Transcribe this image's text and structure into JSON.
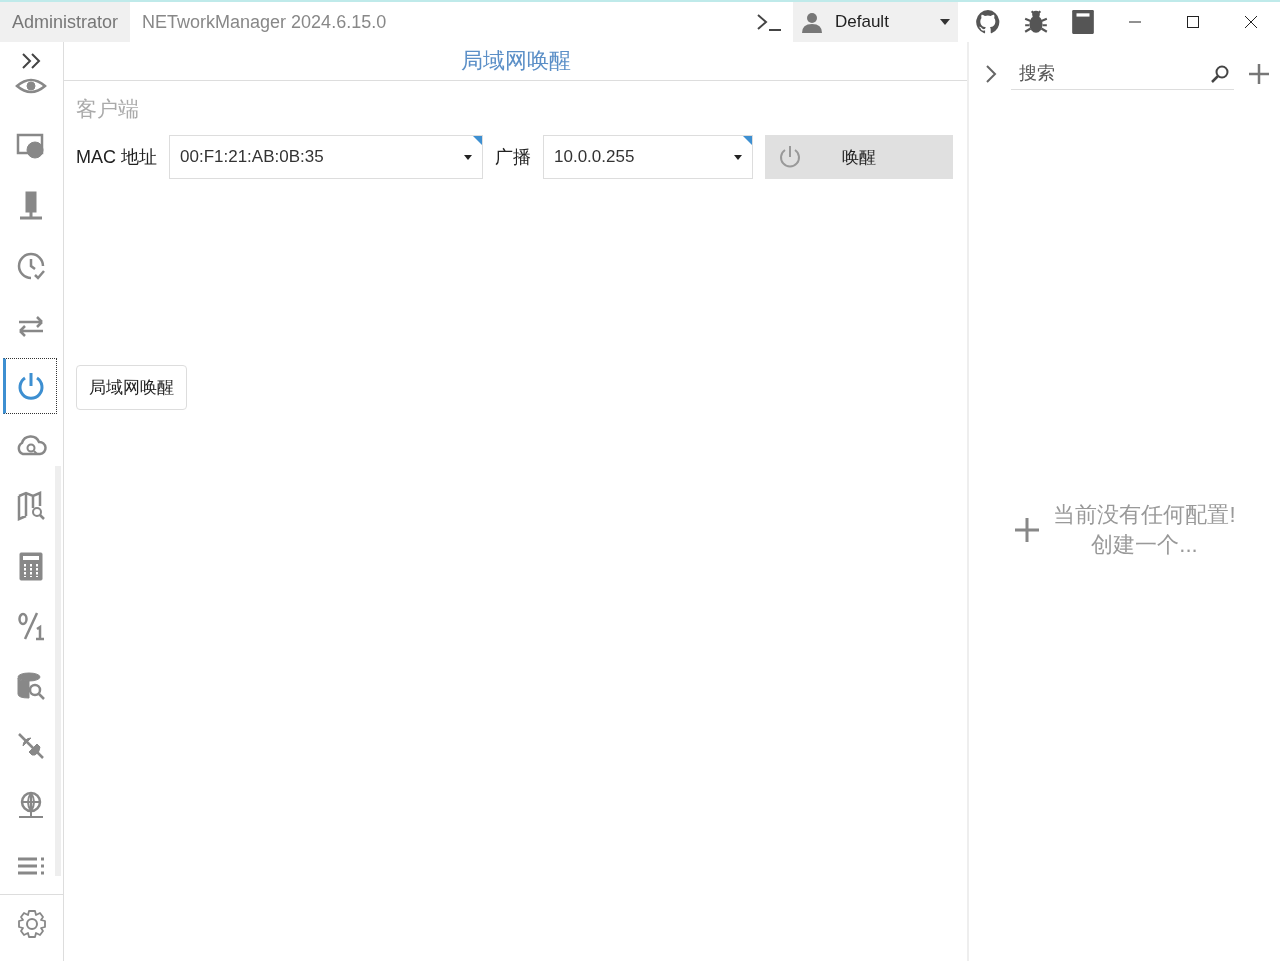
{
  "titlebar": {
    "user": "Administrator",
    "app_title": "NETworkManager 2024.6.15.0",
    "profile": "Default"
  },
  "sidebar": {
    "items": [
      {
        "kind": "eye",
        "selected": false
      },
      {
        "kind": "remote",
        "selected": false
      },
      {
        "kind": "server",
        "selected": false
      },
      {
        "kind": "clock",
        "selected": false
      },
      {
        "kind": "arrows",
        "selected": false
      },
      {
        "kind": "power",
        "selected": true
      },
      {
        "kind": "cloud",
        "selected": false
      },
      {
        "kind": "map",
        "selected": false
      },
      {
        "kind": "calculator",
        "selected": false
      },
      {
        "kind": "binary",
        "selected": false
      },
      {
        "kind": "database",
        "selected": false
      },
      {
        "kind": "plug",
        "selected": false
      },
      {
        "kind": "globe",
        "selected": false
      },
      {
        "kind": "list",
        "selected": false
      }
    ]
  },
  "main": {
    "header": "局域网唤醒",
    "group": "客户端",
    "mac_label": "MAC 地址",
    "mac_value": "00:F1:21:AB:0B:35",
    "broadcast_label": "广播",
    "broadcast_value": "10.0.0.255",
    "wake_button": "唤醒",
    "tab": "局域网唤醒"
  },
  "profiles": {
    "search": {
      "placeholder": "搜索"
    },
    "empty_line1": "当前没有任何配置!",
    "empty_line2": "创建一个..."
  }
}
